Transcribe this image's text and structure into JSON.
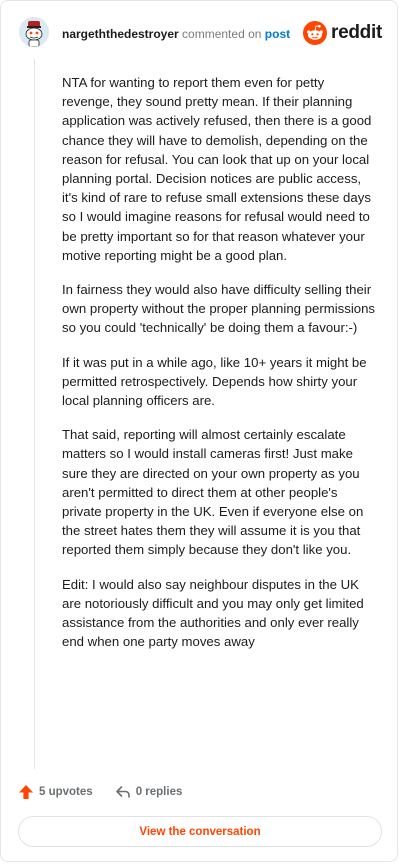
{
  "header": {
    "username": "nargeththedestroyer",
    "action_text": "commented on",
    "post_link": "post",
    "brand": "reddit"
  },
  "comment": {
    "paragraphs": [
      "NTA for wanting to report them even for petty revenge, they sound pretty mean. If their planning application was actively refused, then there is a good chance they will have to demolish, depending on the reason for refusal. You can look that up on your local planning portal. Decision notices are public access, it's kind of rare to refuse small extensions these days so I would imagine reasons for refusal would need to be pretty important so for that reason whatever your motive reporting might be a good plan.",
      "In fairness they would also have difficulty selling their own property without the proper planning permissions so you could 'technically' be doing them a favour:-)",
      "If it was put in a while ago, like 10+ years it might be permitted retrospectively. Depends how shirty your local planning officers are.",
      "That said, reporting will almost certainly escalate matters so I would install cameras first! Just make sure they are directed on your own property as you aren't permitted to direct them at other people's private property in the UK. Even if everyone else on the street hates them they will assume it is you that reported them simply because they don't like you.",
      "Edit: I would also say neighbour disputes in the UK are notoriously difficult and you may only get limited assistance from the authorities and only ever really end when one party moves away"
    ]
  },
  "actions": {
    "upvotes": "5 upvotes",
    "replies": "0 replies"
  },
  "cta": {
    "label": "View the conversation"
  },
  "colors": {
    "brand_orange": "#ff4500",
    "link_blue": "#0079d3"
  },
  "icons": {
    "avatar": "snoo-avatar",
    "logo": "reddit-snoo-icon",
    "upvote": "arrow-up-icon",
    "reply": "reply-arrow-icon"
  }
}
